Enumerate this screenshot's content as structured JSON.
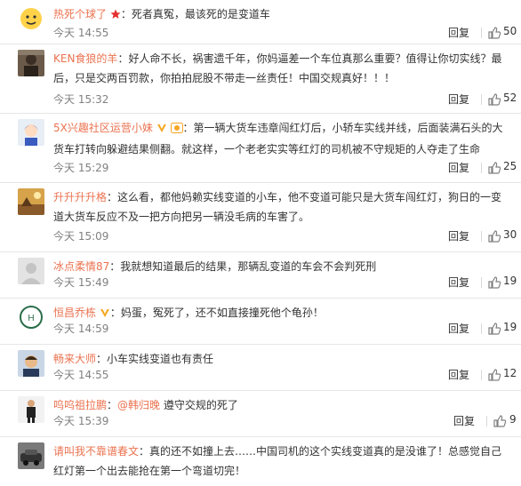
{
  "comments": [
    {
      "user": "热死个球了",
      "text": "死者真冤，最该死的是变道车",
      "time": "今天 14:55",
      "reply": "回复",
      "likes": "50"
    },
    {
      "user": "KEN食狼的羊",
      "text": "好人命不长，祸害遗千年，你妈逼差一个车位真那么重要？值得让你切实线？最后，只是交两百罚款，你拍拍屁股不带走一丝责任！中国交规真好！！！",
      "time": "今天 15:32",
      "reply": "回复",
      "likes": "52"
    },
    {
      "user": "5X兴趣社区运营小妹",
      "text": "第一辆大货车违章闯红灯后，小轿车实线并线，后面装满石头的大货车打转向躲避结果侧翻。就这样，一个老老实实等红灯的司机被不守规矩的人夺走了生命",
      "time": "今天 15:29",
      "reply": "回复",
      "likes": "25"
    },
    {
      "user": "升升升升格",
      "text": "这么看，都他妈赖实线变道的小车，他不变道可能只是大货车闯红灯，狗日的一变道大货车反应不及一把方向把另一辆没毛病的车害了。",
      "time": "今天 15:09",
      "reply": "回复",
      "likes": "30"
    },
    {
      "user": "冰点柔情87",
      "text": "我就想知道最后的结果，那辆乱变道的车会不会判死刑",
      "time": "今天 15:49",
      "reply": "回复",
      "likes": "19"
    },
    {
      "user": "恒昌乔栋",
      "text": "妈蛋，冤死了，还不如直接撞死他个龟孙！",
      "time": "今天 14:59",
      "reply": "回复",
      "likes": "19"
    },
    {
      "user": "畅来大师",
      "text": "小车实线变道也有责任",
      "time": "今天 14:55",
      "reply": "回复",
      "likes": "12"
    },
    {
      "user": "呜呜祖拉鹏",
      "mention": "@韩归晚",
      "text": "遵守交规的死了",
      "time": "今天 15:39",
      "reply": "回复",
      "likes": "9"
    },
    {
      "user": "请叫我不靠谱春文",
      "text": "真的还不如撞上去……中国司机的这个实线变道真的是没谁了！总感觉自己红灯第一个出去能抢在第一个弯道切完！",
      "time": "",
      "reply": "",
      "likes": ""
    }
  ],
  "colors": {
    "username": "#eb7350",
    "text": "#333333",
    "time": "#808080",
    "divider": "#e6e6e6"
  },
  "icons": [
    "like-thumb-icon",
    "vip-v-icon",
    "red-star-icon",
    "fan-badge-icon"
  ]
}
